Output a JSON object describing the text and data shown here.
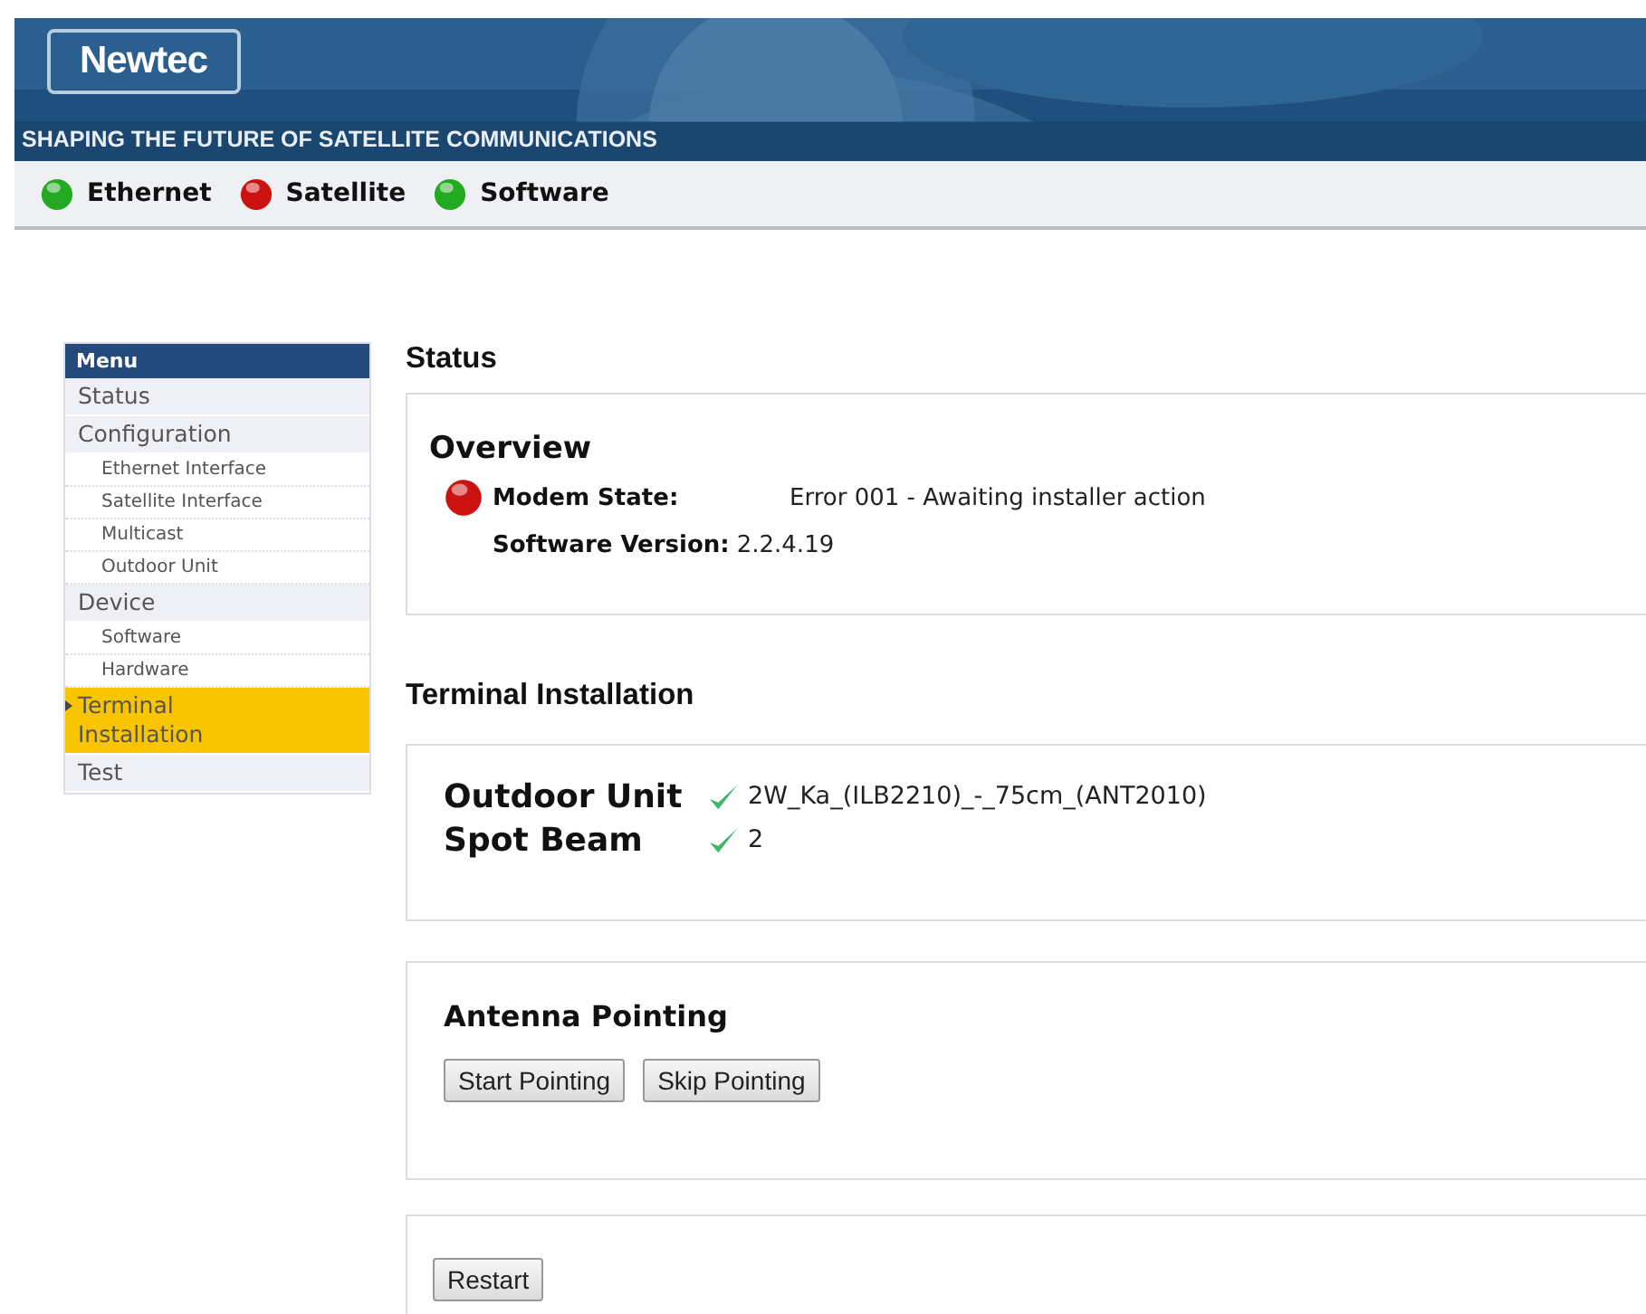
{
  "header": {
    "logo": "Newtec",
    "tagline": "SHAPING THE FUTURE OF SATELLITE COMMUNICATIONS"
  },
  "indicators": [
    {
      "label": "Ethernet",
      "color": "#22aa22"
    },
    {
      "label": "Satellite",
      "color": "#cc1111"
    },
    {
      "label": "Software",
      "color": "#22aa22"
    }
  ],
  "sidebar": {
    "title": "Menu",
    "items": [
      {
        "label": "Status",
        "selected": false
      },
      {
        "label": "Configuration",
        "selected": false,
        "children": [
          {
            "label": "Ethernet Interface",
            "selected": false
          },
          {
            "label": "Satellite Interface",
            "selected": false
          },
          {
            "label": "Multicast",
            "selected": false
          },
          {
            "label": "Outdoor Unit",
            "selected": false
          }
        ]
      },
      {
        "label": "Device",
        "selected": false,
        "children": [
          {
            "label": "Software",
            "selected": false
          },
          {
            "label": "Hardware",
            "selected": false
          }
        ]
      },
      {
        "label": "Terminal Installation",
        "selected": true
      },
      {
        "label": "Test",
        "selected": false
      }
    ]
  },
  "page_title": "Status",
  "overview": {
    "title": "Overview",
    "modem_state": {
      "label": "Modem State:",
      "value": "Error 001 - Awaiting installer action",
      "color": "#cc1111"
    },
    "software_version": {
      "label": "Software Version:",
      "value": "2.2.4.19"
    }
  },
  "terminal_installation": {
    "title": "Terminal Installation",
    "rows": [
      {
        "label": "Outdoor Unit",
        "ok": true,
        "value": "2W_Ka_(ILB2210)_-_75cm_(ANT2010)"
      },
      {
        "label": "Spot Beam",
        "ok": true,
        "value": "2"
      }
    ]
  },
  "antenna_pointing": {
    "title": "Antenna Pointing",
    "buttons": [
      "Start Pointing",
      "Skip Pointing"
    ]
  },
  "restart_button": "Restart"
}
